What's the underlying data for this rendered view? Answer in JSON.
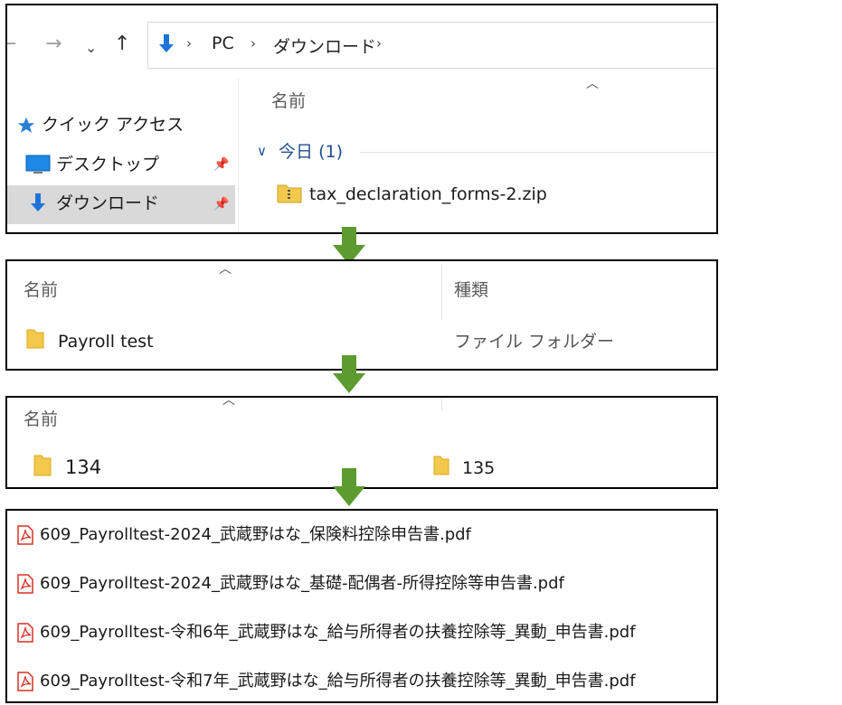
{
  "step1": {
    "breadcrumb": [
      "PC",
      "ダウンロード"
    ],
    "column_header": "名前",
    "sidebar": {
      "quick_access": "クイック アクセス",
      "items": [
        {
          "label": "デスクトップ",
          "icon": "desktop-icon",
          "pinned": true
        },
        {
          "label": "ダウンロード",
          "icon": "download-icon",
          "pinned": true,
          "selected": true
        }
      ]
    },
    "group": {
      "label": "今日",
      "count": "(1)"
    },
    "files": [
      {
        "name": "tax_declaration_forms-2.zip",
        "icon": "zip-folder-icon"
      }
    ]
  },
  "step2": {
    "headers": {
      "name": "名前",
      "type": "種類"
    },
    "rows": [
      {
        "name": "Payroll test",
        "type": "ファイル フォルダー",
        "icon": "folder-icon"
      }
    ]
  },
  "step3": {
    "headers": {
      "name": "名前"
    },
    "folders": [
      {
        "name": "134",
        "icon": "folder-icon"
      },
      {
        "name": "135",
        "icon": "folder-icon"
      }
    ]
  },
  "step4": {
    "files": [
      {
        "name": "609_Payrolltest-2024_武蔵野はな_保険料控除申告書.pdf",
        "icon": "pdf-icon"
      },
      {
        "name": "609_Payrolltest-2024_武蔵野はな_基礎-配偶者-所得控除等申告書.pdf",
        "icon": "pdf-icon"
      },
      {
        "name": "609_Payrolltest-令和6年_武蔵野はな_給与所得者の扶養控除等_異動_申告書.pdf",
        "icon": "pdf-icon"
      },
      {
        "name": "609_Payrolltest-令和7年_武蔵野はな_給与所得者の扶養控除等_異動_申告書.pdf",
        "icon": "pdf-icon"
      }
    ]
  },
  "colors": {
    "arrow": "#5b9b2f",
    "group_header": "#1f4f8f",
    "download_blue": "#1e73d8",
    "folder_yellow": "#f2c94c",
    "pdf_red": "#d93025"
  }
}
